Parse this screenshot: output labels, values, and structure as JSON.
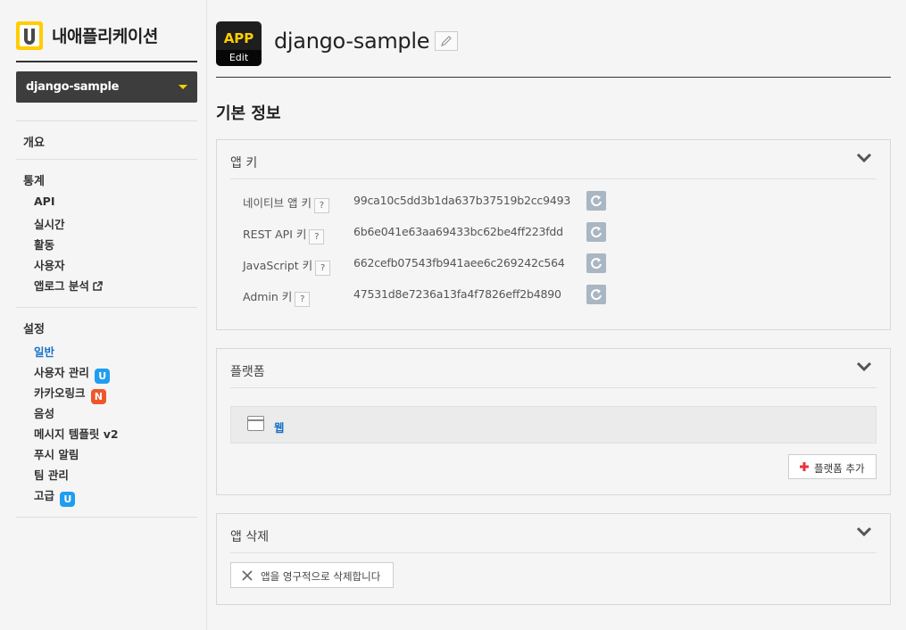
{
  "sidebar": {
    "brand_title": "내애플리케이션",
    "app_selector": "django-sample",
    "overview": "개요",
    "stats": {
      "heading": "통계",
      "items": [
        "API",
        "실시간",
        "활동",
        "사용자",
        "앱로그 분석"
      ]
    },
    "settings": {
      "heading": "설정",
      "items": [
        {
          "label": "일반",
          "badge": "",
          "active": true
        },
        {
          "label": "사용자 관리",
          "badge": "U"
        },
        {
          "label": "카카오링크",
          "badge": "N"
        },
        {
          "label": "음성",
          "badge": ""
        },
        {
          "label": "메시지 템플릿 v2",
          "badge": ""
        },
        {
          "label": "푸시 알림",
          "badge": ""
        },
        {
          "label": "팀 관리",
          "badge": ""
        },
        {
          "label": "고급",
          "badge": "U"
        }
      ]
    }
  },
  "header": {
    "app_icon_text": "APP",
    "app_icon_edit": "Edit",
    "app_name": "django-sample"
  },
  "section_title": "기본 정보",
  "app_keys": {
    "title": "앱 키",
    "help": "?",
    "rows": [
      {
        "label": "네이티브 앱 키",
        "value": "99ca10c5dd3b1da637b37519b2cc9493"
      },
      {
        "label": "REST API 키",
        "value": "6b6e041e63aa69433bc62be4ff223fdd"
      },
      {
        "label": "JavaScript 키",
        "value": "662cefb07543fb941aee6c269242c564"
      },
      {
        "label": "Admin 키",
        "value": "47531d8e7236a13fa4f7826eff2b4890"
      }
    ]
  },
  "platform": {
    "title": "플랫폼",
    "items": [
      "웹"
    ],
    "add_label": "플랫폼 추가"
  },
  "delete_app": {
    "title": "앱 삭제",
    "button_label": "앱을 영구적으로 삭제합니다"
  },
  "colors": {
    "accent_yellow": "#ffcd00",
    "link_blue": "#1a73c7",
    "badge_u": "#1f9ef0",
    "badge_n": "#f0562a",
    "refresh_btn": "#a9b6c3",
    "add_plus": "#e8343a"
  }
}
